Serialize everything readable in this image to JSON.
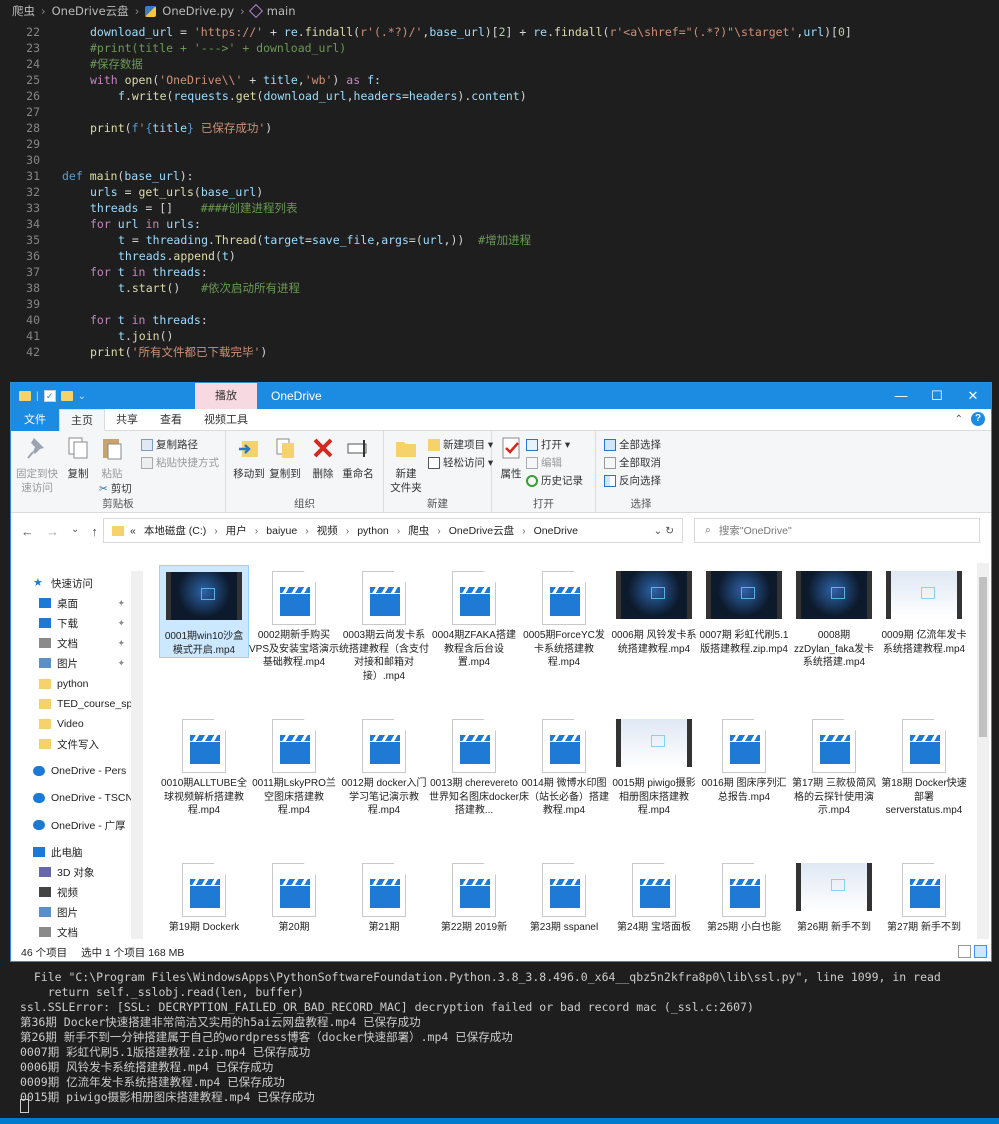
{
  "breadcrumb": [
    "爬虫",
    "OneDrive云盘",
    "OneDrive.py",
    "main"
  ],
  "code_lines": [
    {
      "n": "22",
      "html": "<span class=\"p\">download_url</span> = <span class=\"s\">'https://'</span> + <span class=\"p\">re</span>.<span class=\"f\">findall</span>(<span class=\"s\">r'(.*?)/'</span>,<span class=\"p\">base_url</span>)[<span class=\"n\">2</span>] + <span class=\"p\">re</span>.<span class=\"f\">findall</span>(<span class=\"s\">r'&lt;a\\shref=\"(.*?)\"\\starget'</span>,<span class=\"p\">url</span>)[<span class=\"n\">0</span>]",
      "indent": 2
    },
    {
      "n": "23",
      "html": "<span class=\"c\">#print(title + '--->' + download_url)</span>",
      "indent": 2
    },
    {
      "n": "24",
      "html": "<span class=\"c\">#保存数据</span>",
      "indent": 2
    },
    {
      "n": "25",
      "html": "<span class=\"kc\">with</span> <span class=\"f\">open</span>(<span class=\"s\">'OneDrive\\\\'</span> + <span class=\"p\">title</span>,<span class=\"s\">'wb'</span>) <span class=\"kc\">as</span> <span class=\"p\">f</span>:",
      "indent": 2
    },
    {
      "n": "26",
      "html": "<span class=\"p\">f</span>.<span class=\"f\">write</span>(<span class=\"p\">requests</span>.<span class=\"f\">get</span>(<span class=\"p\">download_url</span>,<span class=\"p\">headers</span>=<span class=\"p\">headers</span>).<span class=\"p\">content</span>)",
      "indent": 4
    },
    {
      "n": "27",
      "html": "",
      "indent": 0
    },
    {
      "n": "28",
      "html": "<span class=\"f\">print</span>(<span class=\"k\">f</span><span class=\"s\">'</span><span class=\"k\">{</span><span class=\"p\">title</span><span class=\"k\">}</span><span class=\"s\"> 已保存成功'</span>)",
      "indent": 2
    },
    {
      "n": "29",
      "html": "",
      "indent": 0
    },
    {
      "n": "30",
      "html": "",
      "indent": 0
    },
    {
      "n": "31",
      "html": "<span class=\"k\">def</span> <span class=\"f\">main</span>(<span class=\"p\">base_url</span>):",
      "indent": 0
    },
    {
      "n": "32",
      "html": "<span class=\"p\">urls</span> = <span class=\"f\">get_urls</span>(<span class=\"p\">base_url</span>)",
      "indent": 2
    },
    {
      "n": "33",
      "html": "<span class=\"p\">threads</span> = []    <span class=\"c\">####创建进程列表</span>",
      "indent": 2
    },
    {
      "n": "34",
      "html": "<span class=\"kc\">for</span> <span class=\"p\">url</span> <span class=\"kc\">in</span> <span class=\"p\">urls</span>:",
      "indent": 2
    },
    {
      "n": "35",
      "html": "<span class=\"p\">t</span> = <span class=\"p\">threading</span>.<span class=\"f\">Thread</span>(<span class=\"p\">target</span>=<span class=\"p\">save_file</span>,<span class=\"p\">args</span>=(<span class=\"p\">url</span>,))  <span class=\"c\">#增加进程</span>",
      "indent": 4
    },
    {
      "n": "36",
      "html": "<span class=\"p\">threads</span>.<span class=\"f\">append</span>(<span class=\"p\">t</span>)",
      "indent": 4
    },
    {
      "n": "37",
      "html": "<span class=\"kc\">for</span> <span class=\"p\">t</span> <span class=\"kc\">in</span> <span class=\"p\">threads</span>:",
      "indent": 2
    },
    {
      "n": "38",
      "html": "<span class=\"p\">t</span>.<span class=\"f\">start</span>()   <span class=\"c\">#依次启动所有进程</span>",
      "indent": 4
    },
    {
      "n": "39",
      "html": "",
      "indent": 0
    },
    {
      "n": "40",
      "html": "<span class=\"kc\">for</span> <span class=\"p\">t</span> <span class=\"kc\">in</span> <span class=\"p\">threads</span>:",
      "indent": 2
    },
    {
      "n": "41",
      "html": "<span class=\"p\">t</span>.<span class=\"f\">join</span>()",
      "indent": 4
    },
    {
      "n": "42",
      "html": "<span class=\"f\">print</span>(<span class=\"s\">'所有文件都已下载完毕'</span>)",
      "indent": 2
    }
  ],
  "explorer": {
    "context_tab": "播放",
    "title": "OneDrive",
    "window_buttons": [
      "—",
      "☐",
      "✕"
    ],
    "tabs": [
      "文件",
      "主页",
      "共享",
      "查看",
      "视频工具"
    ],
    "ribbon": {
      "clipboard": {
        "label": "剪贴板",
        "pin": "固定到快\n速访问",
        "copy": "复制",
        "paste": "粘贴",
        "copy_path": "复制路径",
        "paste_shortcut": "粘贴快捷方式",
        "cut": "剪切"
      },
      "organize": {
        "label": "组织",
        "move_to": "移动到",
        "copy_to": "复制到",
        "delete": "删除",
        "rename": "重命名"
      },
      "new": {
        "label": "新建",
        "new_folder": "新建\n文件夹",
        "new_item": "新建项目 ▾",
        "easy_access": "轻松访问 ▾"
      },
      "open": {
        "label": "打开",
        "properties": "属性",
        "open": "打开 ▾",
        "edit": "编辑",
        "history": "历史记录"
      },
      "select": {
        "label": "选择",
        "select_all": "全部选择",
        "select_none": "全部取消",
        "invert": "反向选择"
      }
    },
    "address": {
      "nav": [
        "←",
        "→",
        "⌄",
        "↑"
      ],
      "path": [
        "«",
        "本地磁盘 (C:)",
        "用户",
        "baiyue",
        "视频",
        "python",
        "爬虫",
        "OneDrive云盘",
        "OneDrive"
      ],
      "search_placeholder": "搜索\"OneDrive\""
    },
    "nav_items": [
      {
        "label": "快速访问",
        "icon": "star-icon",
        "pin": false
      },
      {
        "label": "桌面",
        "icon": "desktop-icon",
        "pin": true
      },
      {
        "label": "下载",
        "icon": "download-icon",
        "pin": true
      },
      {
        "label": "文档",
        "icon": "document-icon",
        "pin": true
      },
      {
        "label": "图片",
        "icon": "picture-icon",
        "pin": true
      },
      {
        "label": "python",
        "icon": "folder-icon",
        "pin": false
      },
      {
        "label": "TED_course_sp",
        "icon": "folder-icon",
        "pin": false
      },
      {
        "label": "Video",
        "icon": "folder-icon",
        "pin": false
      },
      {
        "label": "文件写入",
        "icon": "folder-icon",
        "pin": false
      },
      {
        "label": "OneDrive - Pers",
        "icon": "cloud-icon",
        "pin": false
      },
      {
        "label": "OneDrive - TSCN",
        "icon": "cloud-icon",
        "pin": false
      },
      {
        "label": "OneDrive - 广厚",
        "icon": "cloud-icon",
        "pin": false
      },
      {
        "label": "此电脑",
        "icon": "pc-icon",
        "pin": false
      },
      {
        "label": "3D 对象",
        "icon": "3d-icon",
        "pin": false
      },
      {
        "label": "视频",
        "icon": "video-icon",
        "pin": false
      },
      {
        "label": "图片",
        "icon": "picture-icon",
        "pin": false
      },
      {
        "label": "文档",
        "icon": "document-icon",
        "pin": false
      }
    ],
    "files": [
      {
        "name": "0001期win10沙盒模式开启.mp4",
        "thumb": "video",
        "selected": true
      },
      {
        "name": "0002期新手购买VPS及安装宝塔演示基础教程.mp4",
        "thumb": "file"
      },
      {
        "name": "0003期云尚发卡系统搭建教程（含支付对接和邮箱对接）.mp4",
        "thumb": "file"
      },
      {
        "name": "0004期ZFAKA搭建教程含后台设置.mp4",
        "thumb": "file"
      },
      {
        "name": "0005期ForceYC发卡系统搭建教程.mp4",
        "thumb": "file"
      },
      {
        "name": "0006期 风铃发卡系统搭建教程.mp4",
        "thumb": "video"
      },
      {
        "name": "0007期 彩虹代刷5.1版搭建教程.zip.mp4",
        "thumb": "video"
      },
      {
        "name": "0008期zzDylan_faka发卡系统搭建.mp4",
        "thumb": "video"
      },
      {
        "name": "0009期 亿流年发卡系统搭建教程.mp4",
        "thumb": "light"
      },
      {
        "name": "0010期ALLTUBE全球视频解析搭建教程.mp4",
        "thumb": "file"
      },
      {
        "name": "0011期LskyPRO兰空图床搭建教程.mp4",
        "thumb": "file"
      },
      {
        "name": "0012期 docker入门学习笔记演示教程.mp4",
        "thumb": "file"
      },
      {
        "name": "0013期 cherevereto世界知名图床docker搭建教...",
        "thumb": "file"
      },
      {
        "name": "0014期 微博水印图床（站长必备）搭建教程.mp4",
        "thumb": "file"
      },
      {
        "name": "0015期 piwigo摄影相册图床搭建教程.mp4",
        "thumb": "light"
      },
      {
        "name": "0016期 图床序列汇总报告.mp4",
        "thumb": "file"
      },
      {
        "name": "第17期 三款极简风格的云探针使用演示.mp4",
        "thumb": "file"
      },
      {
        "name": "第18期 Docker快速部署serverstatus.mp4",
        "thumb": "file"
      },
      {
        "name": "第19期 Dockerk",
        "thumb": "file"
      },
      {
        "name": "第20期",
        "thumb": "file"
      },
      {
        "name": "第21期",
        "thumb": "file"
      },
      {
        "name": "第22期 2019新",
        "thumb": "file"
      },
      {
        "name": "第23期 sspanel",
        "thumb": "file"
      },
      {
        "name": "第24期 宝塔面板",
        "thumb": "file"
      },
      {
        "name": "第25期 小白也能",
        "thumb": "file"
      },
      {
        "name": "第26期 新手不到",
        "thumb": "light"
      },
      {
        "name": "第27期 新手不到",
        "thumb": "file"
      }
    ],
    "status": {
      "count": "46 个项目",
      "selected": "选中 1 个项目  168 MB"
    }
  },
  "terminal_lines": [
    "  File \"C:\\Program Files\\WindowsApps\\PythonSoftwareFoundation.Python.3.8_3.8.496.0_x64__qbz5n2kfra8p0\\lib\\ssl.py\", line 1099, in read",
    "    return self._sslobj.read(len, buffer)",
    "ssl.SSLError: [SSL: DECRYPTION_FAILED_OR_BAD_RECORD_MAC] decryption failed or bad record mac (_ssl.c:2607)",
    "第36期 Docker快速搭建非常简洁又实用的h5ai云网盘教程.mp4 已保存成功",
    "第26期 新手不到一分钟搭建属于自己的wordpress博客（docker快速部署）.mp4 已保存成功",
    "0007期 彩虹代刷5.1版搭建教程.zip.mp4 已保存成功",
    "0006期 风铃发卡系统搭建教程.mp4 已保存成功",
    "0009期 亿流年发卡系统搭建教程.mp4 已保存成功",
    "0015期 piwigo摄影相册图床搭建教程.mp4 已保存成功"
  ],
  "colors": {
    "accent": "#1c8ce2",
    "editor_bg": "#1e1e1e",
    "selection": "#cce8ff"
  }
}
